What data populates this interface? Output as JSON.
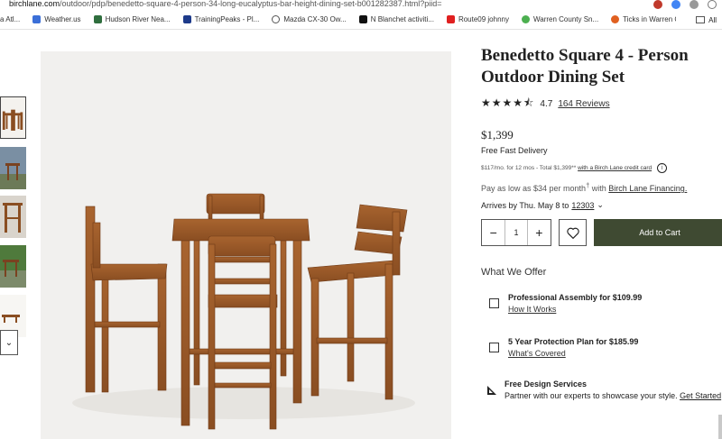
{
  "browser": {
    "url_host": "birchlane.com",
    "url_path": "/outdoor/pdp/benedetto-square-4-person-34-long-eucalyptus-bar-height-dining-set-b001282387.html?piid=",
    "bookmarks": [
      {
        "label": "a Atl...",
        "color": "#ffffff"
      },
      {
        "label": "Weather.us",
        "color": "#3b6fd8"
      },
      {
        "label": "Hudson River Nea...",
        "color": "#2f6e3e"
      },
      {
        "label": "TrainingPeaks - Pl...",
        "color": "#1d3a8a"
      },
      {
        "label": "Mazda CX-30 Ow...",
        "color": "#555555"
      },
      {
        "label": "N Blanchet activiti...",
        "color": "#111111"
      },
      {
        "label": "Route09 johnny",
        "color": "#e02020"
      },
      {
        "label": "Warren County Sn...",
        "color": "#4caf50"
      },
      {
        "label": "Ticks in Warren C...",
        "color": "#e06020"
      }
    ],
    "all_bookmarks_label": "All"
  },
  "product": {
    "title": "Benedetto Square 4 - Person Outdoor Dining Set",
    "stars": "★★★★⯪",
    "rating": "4.7",
    "reviews": "164 Reviews",
    "price": "$1,399",
    "delivery": "Free Fast Delivery",
    "finance_text": "$117/mo. for 12 mos - Total $1,399**",
    "finance_link": "with a Birch Lane credit card",
    "pay_low_prefix": "Pay as low as $34 per month",
    "pay_low_dagger": "†",
    "pay_low_with": " with ",
    "pay_low_link": "Birch Lane Financing.",
    "arrives_prefix": "Arrives by Thu. May 8 to",
    "zip": "12303"
  },
  "cart": {
    "quantity": "1",
    "minus": "−",
    "plus": "+",
    "add_label": "Add to Cart"
  },
  "offers": {
    "heading": "What We Offer",
    "items": [
      {
        "title": "Professional Assembly for $109.99",
        "link": "How It Works"
      },
      {
        "title": "5 Year Protection Plan for $185.99",
        "link": "What's Covered"
      }
    ],
    "design_title": "Free Design Services",
    "design_text": "Partner with our experts to showcase your style. ",
    "design_link": "Get Started"
  },
  "colors": {
    "accent": "#3f4a32",
    "wood": "#9a5a2c"
  }
}
